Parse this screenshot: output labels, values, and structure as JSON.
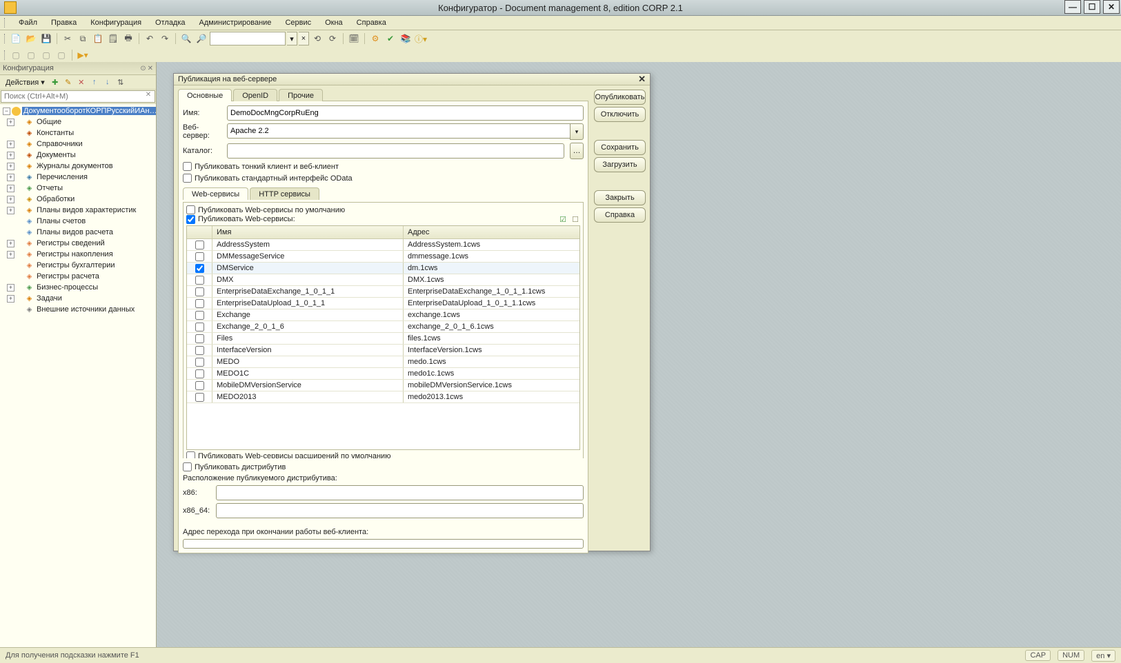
{
  "window": {
    "title": "Конфигуратор - Document management 8, edition CORP 2.1"
  },
  "menu": {
    "file": "Файл",
    "edit": "Правка",
    "config": "Конфигурация",
    "debug": "Отладка",
    "admin": "Администрирование",
    "service": "Сервис",
    "windows": "Окна",
    "help": "Справка"
  },
  "left_panel": {
    "title": "Конфигурация",
    "actions_label": "Действия ▾",
    "search_placeholder": "Поиск (Ctrl+Alt+M)",
    "root": "ДокументооборотКОРПРусскийИАн…",
    "nodes": [
      {
        "id": "common",
        "label": "Общие",
        "icon": "ic-common",
        "expand": "+"
      },
      {
        "id": "constants",
        "label": "Константы",
        "icon": "ic-const",
        "expand": ""
      },
      {
        "id": "refs",
        "label": "Справочники",
        "icon": "ic-ref",
        "expand": "+"
      },
      {
        "id": "docs",
        "label": "Документы",
        "icon": "ic-doc",
        "expand": "+"
      },
      {
        "id": "journals",
        "label": "Журналы документов",
        "icon": "ic-journal",
        "expand": "+"
      },
      {
        "id": "enums",
        "label": "Перечисления",
        "icon": "ic-enum",
        "expand": "+"
      },
      {
        "id": "reports",
        "label": "Отчеты",
        "icon": "ic-report",
        "expand": "+"
      },
      {
        "id": "proc",
        "label": "Обработки",
        "icon": "ic-proc",
        "expand": "+"
      },
      {
        "id": "pvc",
        "label": "Планы видов характеристик",
        "icon": "ic-pvc",
        "expand": "+"
      },
      {
        "id": "plans",
        "label": "Планы счетов",
        "icon": "ic-plans",
        "expand": ""
      },
      {
        "id": "calc",
        "label": "Планы видов расчета",
        "icon": "ic-calc",
        "expand": ""
      },
      {
        "id": "reginfo",
        "label": "Регистры сведений",
        "icon": "ic-reginfo",
        "expand": "+"
      },
      {
        "id": "regnak",
        "label": "Регистры накопления",
        "icon": "ic-regnak",
        "expand": "+"
      },
      {
        "id": "regbuh",
        "label": "Регистры бухгалтерии",
        "icon": "ic-regbuh",
        "expand": ""
      },
      {
        "id": "regcalc",
        "label": "Регистры расчета",
        "icon": "ic-regcalc",
        "expand": ""
      },
      {
        "id": "bp",
        "label": "Бизнес-процессы",
        "icon": "ic-bp",
        "expand": "+"
      },
      {
        "id": "tasks",
        "label": "Задачи",
        "icon": "ic-task",
        "expand": "+"
      },
      {
        "id": "ext",
        "label": "Внешние источники данных",
        "icon": "ic-ext",
        "expand": ""
      }
    ]
  },
  "dialog": {
    "title": "Публикация на веб-сервере",
    "tabs": {
      "main": "Основные",
      "openid": "OpenID",
      "other": "Прочие"
    },
    "buttons": {
      "publish": "Опубликовать",
      "disconnect": "Отключить",
      "save": "Сохранить",
      "load": "Загрузить",
      "close": "Закрыть",
      "help": "Справка"
    },
    "fields": {
      "name_label": "Имя:",
      "name_value": "DemoDocMngCorpRuEng",
      "webserver_label": "Веб-сервер:",
      "webserver_value": "Apache 2.2",
      "catalog_label": "Каталог:",
      "catalog_value": ""
    },
    "checks": {
      "thin": "Публиковать тонкий клиент и веб-клиент",
      "odata": "Публиковать стандартный интерфейс OData"
    },
    "inner_tabs": {
      "web": "Web-сервисы",
      "http": "HTTP сервисы"
    },
    "ws_checks": {
      "default": "Публиковать Web-сервисы по умолчанию",
      "publish": "Публиковать Web-сервисы:"
    },
    "table": {
      "col_name": "Имя",
      "col_addr": "Адрес",
      "rows": [
        {
          "checked": false,
          "name": "AddressSystem",
          "addr": "AddressSystem.1cws"
        },
        {
          "checked": false,
          "name": "DMMessageService",
          "addr": "dmmessage.1cws"
        },
        {
          "checked": true,
          "name": "DMService",
          "addr": "dm.1cws"
        },
        {
          "checked": false,
          "name": "DMX",
          "addr": "DMX.1cws"
        },
        {
          "checked": false,
          "name": "EnterpriseDataExchange_1_0_1_1",
          "addr": "EnterpriseDataExchange_1_0_1_1.1cws"
        },
        {
          "checked": false,
          "name": "EnterpriseDataUpload_1_0_1_1",
          "addr": "EnterpriseDataUpload_1_0_1_1.1cws"
        },
        {
          "checked": false,
          "name": "Exchange",
          "addr": "exchange.1cws"
        },
        {
          "checked": false,
          "name": "Exchange_2_0_1_6",
          "addr": "exchange_2_0_1_6.1cws"
        },
        {
          "checked": false,
          "name": "Files",
          "addr": "files.1cws"
        },
        {
          "checked": false,
          "name": "InterfaceVersion",
          "addr": "InterfaceVersion.1cws"
        },
        {
          "checked": false,
          "name": "MEDO",
          "addr": "medo.1cws"
        },
        {
          "checked": false,
          "name": "MEDO1C",
          "addr": "medo1c.1cws"
        },
        {
          "checked": false,
          "name": "MobileDMVersionService",
          "addr": "mobileDMVersionService.1cws"
        },
        {
          "checked": false,
          "name": "MEDO2013",
          "addr": "medo2013.1cws"
        }
      ]
    },
    "ext_default": "Публиковать Web-сервисы расширений по умолчанию",
    "distr_check": "Публиковать дистрибутив",
    "distr_label": "Расположение публикуемого дистрибутива:",
    "x86_label": "x86:",
    "x86_value": "",
    "x86_64_label": "x86_64:",
    "x86_64_value": "",
    "redirect_label": "Адрес перехода при окончании работы веб-клиента:",
    "redirect_value": ""
  },
  "status": {
    "hint": "Для получения подсказки нажмите F1",
    "cap": "CAP",
    "num": "NUM",
    "lang": "en ▾"
  }
}
